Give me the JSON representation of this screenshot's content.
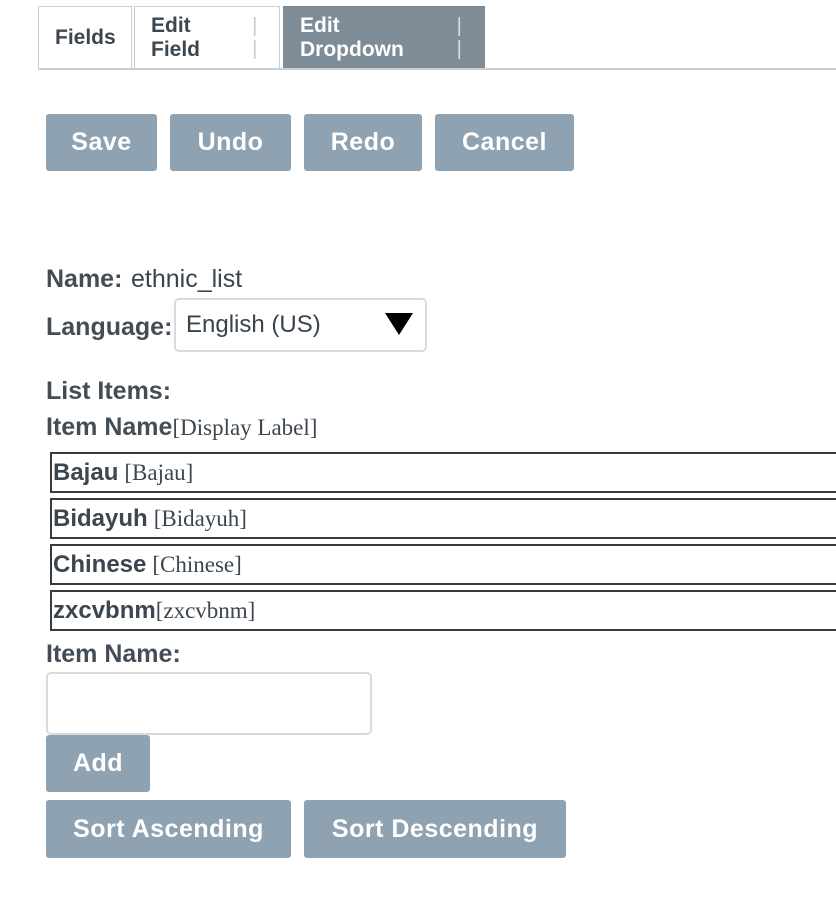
{
  "tabs": [
    {
      "label": "Fields",
      "active": false
    },
    {
      "label": "Edit Field",
      "separator": "| |",
      "active": false
    },
    {
      "label": "Edit Dropdown",
      "separator": "| |",
      "active": true
    }
  ],
  "toolbar": {
    "save_label": "Save",
    "undo_label": "Undo",
    "redo_label": "Redo",
    "cancel_label": "Cancel"
  },
  "form": {
    "name_label": "Name:",
    "name_value": "ethnic_list",
    "language_label": "Language:",
    "language_value": "English (US)",
    "list_items_label": "List Items:",
    "item_name_header": "Item Name",
    "display_label_header": "[Display Label]"
  },
  "list_items": [
    {
      "name": "Bajau",
      "display": "[Bajau]"
    },
    {
      "name": "Bidayuh",
      "display": "[Bidayuh]"
    },
    {
      "name": "Chinese",
      "display": "[Chinese]"
    },
    {
      "name": "zxcvbnm",
      "display": "[zxcvbnm]"
    }
  ],
  "new_item": {
    "label": "Item Name:",
    "value": "",
    "add_label": "Add"
  },
  "sort": {
    "ascending_label": "Sort Ascending",
    "descending_label": "Sort Descending"
  },
  "colors": {
    "button_bg": "#8fa2b2",
    "active_tab_bg": "#7e8c98",
    "text": "#444d55"
  }
}
